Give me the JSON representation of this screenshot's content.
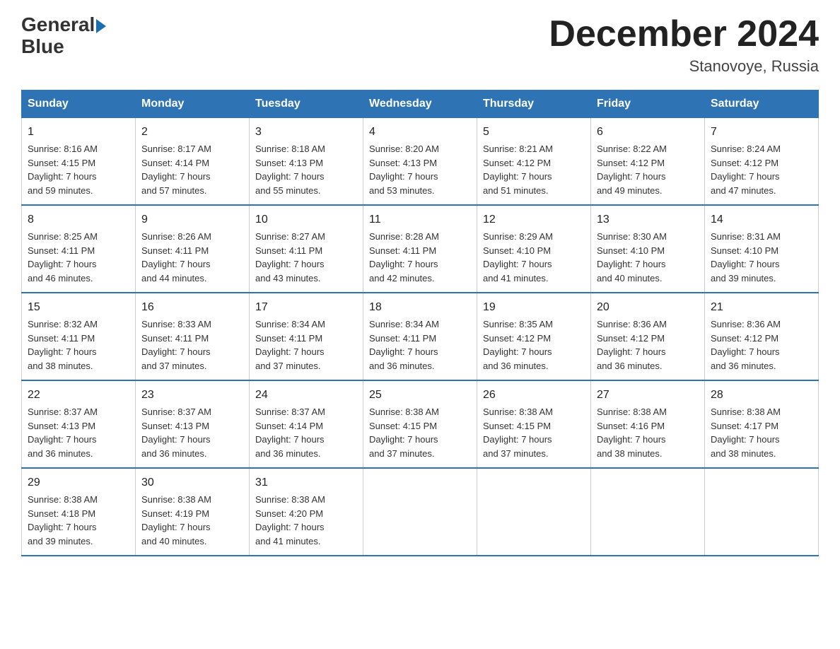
{
  "logo": {
    "text_general": "General",
    "text_blue": "Blue",
    "arrow": "▶"
  },
  "header": {
    "title": "December 2024",
    "subtitle": "Stanovoye, Russia"
  },
  "weekdays": [
    "Sunday",
    "Monday",
    "Tuesday",
    "Wednesday",
    "Thursday",
    "Friday",
    "Saturday"
  ],
  "weeks": [
    [
      {
        "day": "1",
        "info": "Sunrise: 8:16 AM\nSunset: 4:15 PM\nDaylight: 7 hours\nand 59 minutes."
      },
      {
        "day": "2",
        "info": "Sunrise: 8:17 AM\nSunset: 4:14 PM\nDaylight: 7 hours\nand 57 minutes."
      },
      {
        "day": "3",
        "info": "Sunrise: 8:18 AM\nSunset: 4:13 PM\nDaylight: 7 hours\nand 55 minutes."
      },
      {
        "day": "4",
        "info": "Sunrise: 8:20 AM\nSunset: 4:13 PM\nDaylight: 7 hours\nand 53 minutes."
      },
      {
        "day": "5",
        "info": "Sunrise: 8:21 AM\nSunset: 4:12 PM\nDaylight: 7 hours\nand 51 minutes."
      },
      {
        "day": "6",
        "info": "Sunrise: 8:22 AM\nSunset: 4:12 PM\nDaylight: 7 hours\nand 49 minutes."
      },
      {
        "day": "7",
        "info": "Sunrise: 8:24 AM\nSunset: 4:12 PM\nDaylight: 7 hours\nand 47 minutes."
      }
    ],
    [
      {
        "day": "8",
        "info": "Sunrise: 8:25 AM\nSunset: 4:11 PM\nDaylight: 7 hours\nand 46 minutes."
      },
      {
        "day": "9",
        "info": "Sunrise: 8:26 AM\nSunset: 4:11 PM\nDaylight: 7 hours\nand 44 minutes."
      },
      {
        "day": "10",
        "info": "Sunrise: 8:27 AM\nSunset: 4:11 PM\nDaylight: 7 hours\nand 43 minutes."
      },
      {
        "day": "11",
        "info": "Sunrise: 8:28 AM\nSunset: 4:11 PM\nDaylight: 7 hours\nand 42 minutes."
      },
      {
        "day": "12",
        "info": "Sunrise: 8:29 AM\nSunset: 4:10 PM\nDaylight: 7 hours\nand 41 minutes."
      },
      {
        "day": "13",
        "info": "Sunrise: 8:30 AM\nSunset: 4:10 PM\nDaylight: 7 hours\nand 40 minutes."
      },
      {
        "day": "14",
        "info": "Sunrise: 8:31 AM\nSunset: 4:10 PM\nDaylight: 7 hours\nand 39 minutes."
      }
    ],
    [
      {
        "day": "15",
        "info": "Sunrise: 8:32 AM\nSunset: 4:11 PM\nDaylight: 7 hours\nand 38 minutes."
      },
      {
        "day": "16",
        "info": "Sunrise: 8:33 AM\nSunset: 4:11 PM\nDaylight: 7 hours\nand 37 minutes."
      },
      {
        "day": "17",
        "info": "Sunrise: 8:34 AM\nSunset: 4:11 PM\nDaylight: 7 hours\nand 37 minutes."
      },
      {
        "day": "18",
        "info": "Sunrise: 8:34 AM\nSunset: 4:11 PM\nDaylight: 7 hours\nand 36 minutes."
      },
      {
        "day": "19",
        "info": "Sunrise: 8:35 AM\nSunset: 4:12 PM\nDaylight: 7 hours\nand 36 minutes."
      },
      {
        "day": "20",
        "info": "Sunrise: 8:36 AM\nSunset: 4:12 PM\nDaylight: 7 hours\nand 36 minutes."
      },
      {
        "day": "21",
        "info": "Sunrise: 8:36 AM\nSunset: 4:12 PM\nDaylight: 7 hours\nand 36 minutes."
      }
    ],
    [
      {
        "day": "22",
        "info": "Sunrise: 8:37 AM\nSunset: 4:13 PM\nDaylight: 7 hours\nand 36 minutes."
      },
      {
        "day": "23",
        "info": "Sunrise: 8:37 AM\nSunset: 4:13 PM\nDaylight: 7 hours\nand 36 minutes."
      },
      {
        "day": "24",
        "info": "Sunrise: 8:37 AM\nSunset: 4:14 PM\nDaylight: 7 hours\nand 36 minutes."
      },
      {
        "day": "25",
        "info": "Sunrise: 8:38 AM\nSunset: 4:15 PM\nDaylight: 7 hours\nand 37 minutes."
      },
      {
        "day": "26",
        "info": "Sunrise: 8:38 AM\nSunset: 4:15 PM\nDaylight: 7 hours\nand 37 minutes."
      },
      {
        "day": "27",
        "info": "Sunrise: 8:38 AM\nSunset: 4:16 PM\nDaylight: 7 hours\nand 38 minutes."
      },
      {
        "day": "28",
        "info": "Sunrise: 8:38 AM\nSunset: 4:17 PM\nDaylight: 7 hours\nand 38 minutes."
      }
    ],
    [
      {
        "day": "29",
        "info": "Sunrise: 8:38 AM\nSunset: 4:18 PM\nDaylight: 7 hours\nand 39 minutes."
      },
      {
        "day": "30",
        "info": "Sunrise: 8:38 AM\nSunset: 4:19 PM\nDaylight: 7 hours\nand 40 minutes."
      },
      {
        "day": "31",
        "info": "Sunrise: 8:38 AM\nSunset: 4:20 PM\nDaylight: 7 hours\nand 41 minutes."
      },
      {
        "day": "",
        "info": ""
      },
      {
        "day": "",
        "info": ""
      },
      {
        "day": "",
        "info": ""
      },
      {
        "day": "",
        "info": ""
      }
    ]
  ]
}
